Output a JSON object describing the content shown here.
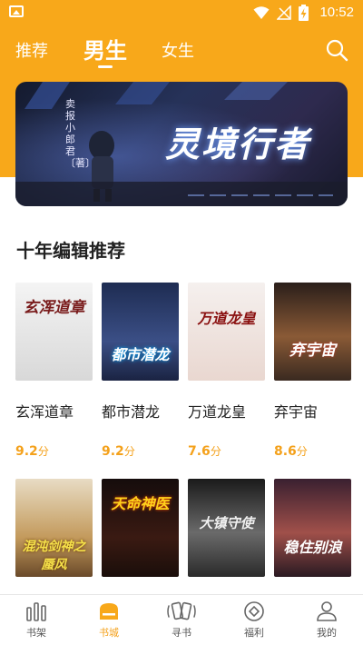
{
  "status_bar": {
    "time": "10:52"
  },
  "tabs": [
    {
      "label": "推荐"
    },
    {
      "label": "男生"
    },
    {
      "label": "女生"
    }
  ],
  "banner": {
    "title": "灵境行者",
    "author_vertical": "卖报小郎君〔著〕"
  },
  "section": {
    "title": "十年编辑推荐"
  },
  "books_row1": [
    {
      "name": "玄浑道章",
      "score": "9.2",
      "unit": "分",
      "cover_text": "玄浑道章"
    },
    {
      "name": "都市潜龙",
      "score": "9.2",
      "unit": "分",
      "cover_text": "都市潜龙"
    },
    {
      "name": "万道龙皇",
      "score": "7.6",
      "unit": "分",
      "cover_text": "万道龙皇"
    },
    {
      "name": "弃宇宙",
      "score": "8.6",
      "unit": "分",
      "cover_text": "弃宇宙"
    }
  ],
  "books_row2": [
    {
      "cover_text": "混沌剑神之蜃风"
    },
    {
      "cover_text": "天命神医"
    },
    {
      "cover_text": "大镇守使"
    },
    {
      "cover_text": "稳住别浪"
    }
  ],
  "bottom_nav": [
    {
      "label": "书架",
      "icon": "bookshelf-icon"
    },
    {
      "label": "书城",
      "icon": "bookstore-icon"
    },
    {
      "label": "寻书",
      "icon": "find-book-icon"
    },
    {
      "label": "福利",
      "icon": "welfare-icon"
    },
    {
      "label": "我的",
      "icon": "profile-icon"
    }
  ],
  "colors": {
    "accent": "#f8a81a",
    "score": "#f4a11b",
    "nav_active": "#f4a11b"
  }
}
